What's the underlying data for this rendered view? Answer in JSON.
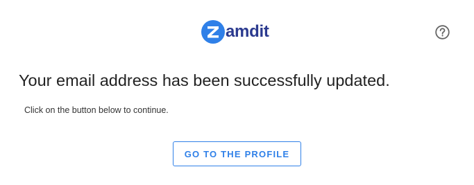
{
  "header": {
    "logo": {
      "letter": "Z",
      "text": "amdit",
      "brand_color": "#2f80e8",
      "text_color": "#2b3a8f"
    },
    "help_icon": "help-circle-icon"
  },
  "main": {
    "headline": "Your email address has been successfully updated.",
    "subtext": "Click on the button below to continue.",
    "button_label": "GO TO THE PROFILE",
    "accent_color": "#2f80e8"
  }
}
